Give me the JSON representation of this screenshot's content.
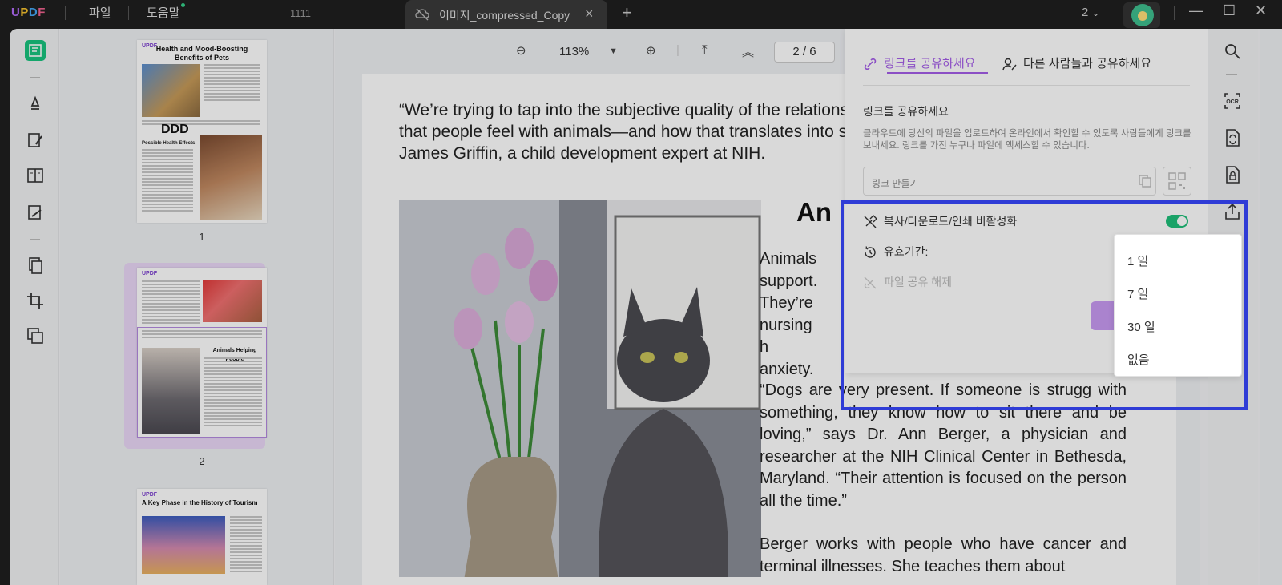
{
  "titlebar": {
    "logo": [
      "U",
      "P",
      "D",
      "F"
    ],
    "menu_file": "파일",
    "menu_help": "도움말",
    "page_count": "1111",
    "tab_title": "이미지_compressed_Copy",
    "window_count": "2"
  },
  "toolbar": {
    "zoom": "113%",
    "page_current": "2",
    "page_sep": "/",
    "page_total": "6"
  },
  "thumbnails": [
    {
      "number": "1",
      "title": "Health and Mood-Boosting Benefits of Pets",
      "overlay_text": "DDD",
      "subheading": "Possible Health Effects"
    },
    {
      "number": "2",
      "title": "Animals Helping People"
    },
    {
      "number": "",
      "title": "A Key Phase in the History of Tourism"
    }
  ],
  "document": {
    "quote1": "“We’re trying to tap into the subjective quality of the relationship that people feel with animals—and how that translates into s James Griffin, a child development expert at NIH.",
    "heading": "An",
    "p1": "Animals support. They’re nursing h anxiety.",
    "p2": "“Dogs are very present. If someone is strugg with something, they know how to sit there and be loving,” says Dr. Ann Berger, a physician and researcher at the NIH Clinical Center in Bethesda, Maryland. “Their attention is focused on the person all the time.”",
    "p3": "Berger works with people who have cancer and terminal illnesses. She teaches them about"
  },
  "share": {
    "tab_link": "링크를 공유하세요",
    "tab_others": "다른 사람들과 공유하세요",
    "heading": "링크를 공유하세요",
    "description": "클라우드에 당신의 파일을 업로드하여 온라인에서 확인할 수 있도록 사람들에게 링크를 보내세요. 링크를 가진 누구나 파일에 액세스할 수 있습니다.",
    "link_placeholder": "링크 만들기",
    "disable_copy_label": "복사/다운로드/인쇄 비활성화",
    "disable_copy_on": true,
    "expiry_label": "유효기간:",
    "expiry_value": "없음",
    "unshare_label": "파일 공유 해제",
    "expiry_options": [
      "1 일",
      "7 일",
      "30 일",
      "없음"
    ]
  },
  "colors": {
    "accent": "#a45de8",
    "toggle_on": "#1fbf7a",
    "highlight": "#2f3cd6",
    "logo": [
      "#b36cf7",
      "#f5c12e",
      "#43a7f5",
      "#f0628f"
    ]
  }
}
